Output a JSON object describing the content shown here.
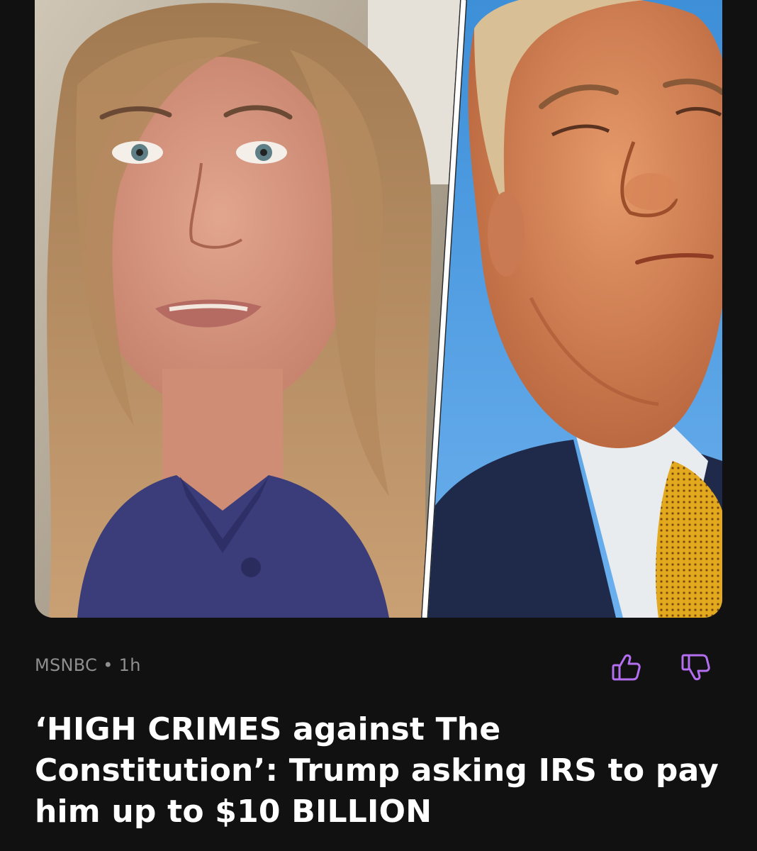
{
  "article": {
    "source": "MSNBC",
    "separator": "•",
    "age": "1h",
    "headline": "‘HIGH CRIMES against The Constitution’: Trump asking IRS to pay him up to $10 BILLION"
  },
  "actions": {
    "thumbs_up_icon": "thumbs-up-icon",
    "thumbs_down_icon": "thumbs-down-icon"
  },
  "colors": {
    "background": "#111111",
    "accent": "#b46ef0",
    "meta_text": "#8f8f8f",
    "headline_text": "#ffffff"
  }
}
